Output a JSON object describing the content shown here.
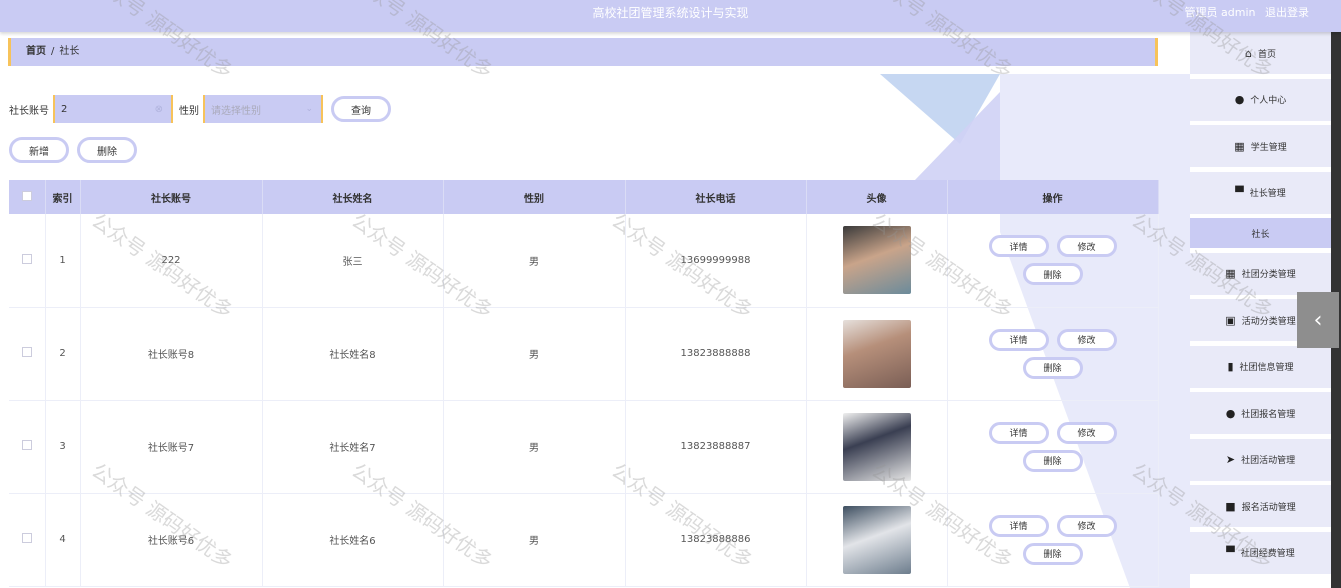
{
  "header": {
    "title": "高校社团管理系统设计与实现",
    "user_label": "管理员 admin",
    "logout": "退出登录"
  },
  "breadcrumb": {
    "home": "首页",
    "current": "社长"
  },
  "search": {
    "account_label": "社长账号",
    "account_value": "2",
    "gender_label": "性别",
    "gender_placeholder": "请选择性别",
    "query_button": "查询"
  },
  "actions": {
    "add": "新增",
    "delete": "删除"
  },
  "table": {
    "headers": [
      "",
      "索引",
      "社长账号",
      "社长姓名",
      "性别",
      "社长电话",
      "头像",
      "操作"
    ],
    "rows": [
      {
        "index": "1",
        "account": "222",
        "name": "张三",
        "gender": "男",
        "phone": "13699999988"
      },
      {
        "index": "2",
        "account": "社长账号8",
        "name": "社长姓名8",
        "gender": "男",
        "phone": "13823888888"
      },
      {
        "index": "3",
        "account": "社长账号7",
        "name": "社长姓名7",
        "gender": "男",
        "phone": "13823888887"
      },
      {
        "index": "4",
        "account": "社长账号6",
        "name": "社长姓名6",
        "gender": "男",
        "phone": "13823888886"
      }
    ],
    "row_actions": {
      "detail": "详情",
      "edit": "修改",
      "delete": "删除"
    }
  },
  "sidebar": {
    "items": [
      {
        "label": "首页",
        "icon": "home-icon",
        "glyph": "⌂"
      },
      {
        "label": "个人中心",
        "icon": "user-icon",
        "glyph": "●"
      },
      {
        "label": "学生管理",
        "icon": "grid-icon",
        "glyph": "▦"
      },
      {
        "label": "社长管理",
        "icon": "monitor-icon",
        "glyph": "▀"
      },
      {
        "label": "社长",
        "sub": true
      },
      {
        "label": "社团分类管理",
        "icon": "grid-icon",
        "glyph": "▦"
      },
      {
        "label": "活动分类管理",
        "icon": "calendar-icon",
        "glyph": "▣"
      },
      {
        "label": "社团信息管理",
        "icon": "bar-chart-icon",
        "glyph": "▮"
      },
      {
        "label": "社团报名管理",
        "icon": "user-icon",
        "glyph": "●"
      },
      {
        "label": "社团活动管理",
        "icon": "send-icon",
        "glyph": "➤"
      },
      {
        "label": "报名活动管理",
        "icon": "video-icon",
        "glyph": "■"
      },
      {
        "label": "社团经费管理",
        "icon": "monitor-icon",
        "glyph": "▀"
      }
    ]
  },
  "watermark": "公众号 源码好优多",
  "colors": {
    "accent": "#c9cbf3",
    "border_accent": "#f7c35a"
  }
}
